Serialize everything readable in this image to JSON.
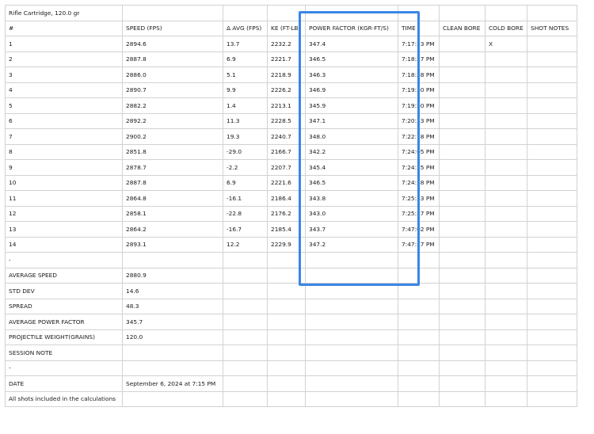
{
  "title": "Rifle Cartridge, 120.0 gr",
  "headers": [
    "#",
    "SPEED (FPS)",
    "Δ AVG (FPS)",
    "KE (FT-LB)",
    "POWER FACTOR (KGR⋅FT/S)",
    "TIME",
    "CLEAN BORE",
    "COLD BORE",
    "SHOT NOTES"
  ],
  "shots": [
    [
      "1",
      "2894.6",
      "13.7",
      "2232.2",
      "347.4",
      "7:17:53 PM",
      "",
      "X",
      ""
    ],
    [
      "2",
      "2887.8",
      "6.9",
      "2221.7",
      "346.5",
      "7:18:27 PM",
      "",
      "",
      ""
    ],
    [
      "3",
      "2886.0",
      "5.1",
      "2218.9",
      "346.3",
      "7:18:58 PM",
      "",
      "",
      ""
    ],
    [
      "4",
      "2890.7",
      "9.9",
      "2226.2",
      "346.9",
      "7:19:30 PM",
      "",
      "",
      ""
    ],
    [
      "5",
      "2882.2",
      "1.4",
      "2213.1",
      "345.9",
      "7:19:50 PM",
      "",
      "",
      ""
    ],
    [
      "6",
      "2892.2",
      "11.3",
      "2228.5",
      "347.1",
      "7:20:33 PM",
      "",
      "",
      ""
    ],
    [
      "7",
      "2900.2",
      "19.3",
      "2240.7",
      "348.0",
      "7:22:18 PM",
      "",
      "",
      ""
    ],
    [
      "8",
      "2851.8",
      "-29.0",
      "2166.7",
      "342.2",
      "7:24:05 PM",
      "",
      "",
      ""
    ],
    [
      "9",
      "2878.7",
      "-2.2",
      "2207.7",
      "345.4",
      "7:24:35 PM",
      "",
      "",
      ""
    ],
    [
      "10",
      "2887.8",
      "6.9",
      "2221.6",
      "346.5",
      "7:24:58 PM",
      "",
      "",
      ""
    ],
    [
      "11",
      "2864.8",
      "-16.1",
      "2186.4",
      "343.8",
      "7:25:33 PM",
      "",
      "",
      ""
    ],
    [
      "12",
      "2858.1",
      "-22.8",
      "2176.2",
      "343.0",
      "7:25:57 PM",
      "",
      "",
      ""
    ],
    [
      "13",
      "2864.2",
      "-16.7",
      "2185.4",
      "343.7",
      "7:47:02 PM",
      "",
      "",
      ""
    ],
    [
      "14",
      "2893.1",
      "12.2",
      "2229.9",
      "347.2",
      "7:47:57 PM",
      "",
      "",
      ""
    ]
  ],
  "separator_1": "-",
  "summary": [
    {
      "label": "AVERAGE SPEED",
      "value": "2880.9"
    },
    {
      "label": "STD DEV",
      "value": "14.6"
    },
    {
      "label": "SPREAD",
      "value": "48.3"
    },
    {
      "label": "AVERAGE POWER FACTOR",
      "value": "345.7"
    },
    {
      "label": "PROJECTILE WEIGHT(GRAINS)",
      "value": "120.0"
    },
    {
      "label": "SESSION NOTE",
      "value": ""
    }
  ],
  "separator_2": "-",
  "date": {
    "label": "DATE",
    "value": "September 6, 2024 at 7:15 PM"
  },
  "footer_note": "All shots included in the calculations",
  "highlight_color": "#3a86e6"
}
